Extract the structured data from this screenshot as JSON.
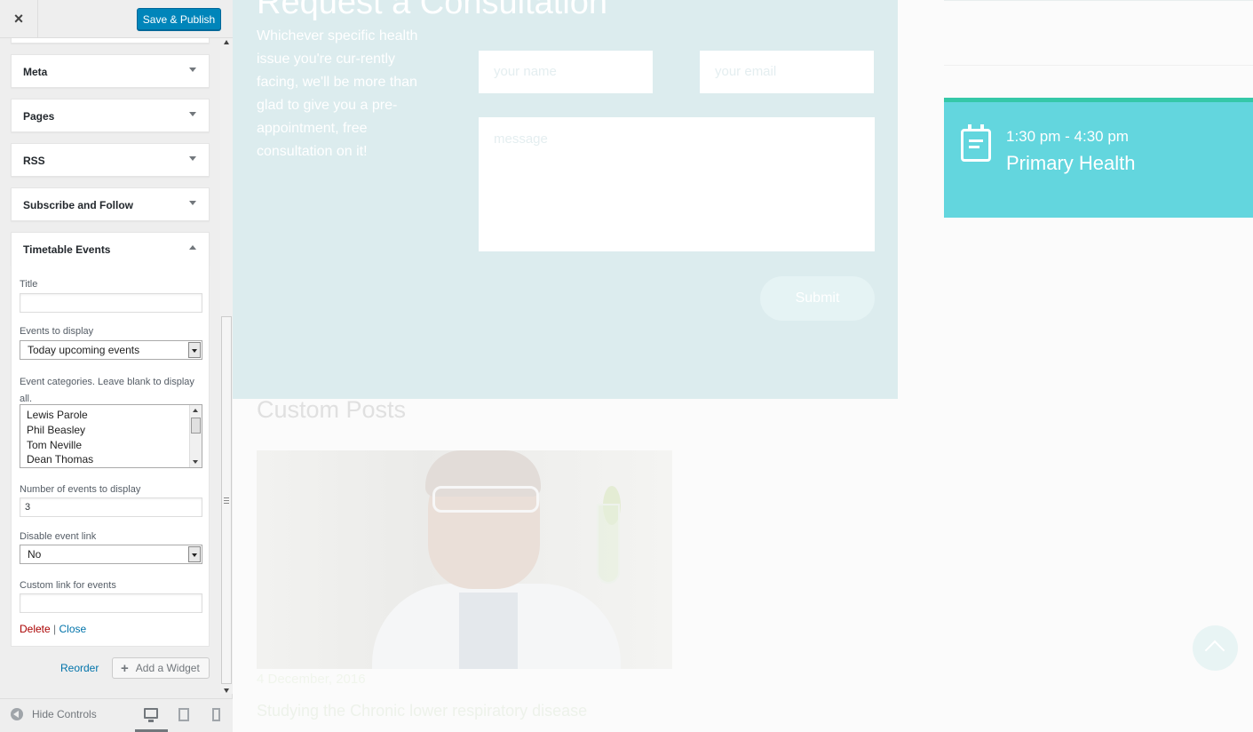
{
  "header": {
    "close_label": "×",
    "publish_label": "Save & Publish"
  },
  "widgets": [
    {
      "title": "Meta"
    },
    {
      "title": "Pages"
    },
    {
      "title": "RSS"
    },
    {
      "title": "Subscribe and Follow"
    },
    {
      "title": "Timetable Events"
    }
  ],
  "timetable_form": {
    "title_label": "Title",
    "title_value": "",
    "events_label": "Events to display",
    "events_value": "Today upcoming events",
    "categories_label": "Event categories. Leave blank to display all.",
    "categories": [
      "Lewis Parole",
      "Phil Beasley",
      "Tom Neville",
      "Dean Thomas"
    ],
    "number_label": "Number of events to display",
    "number_value": "3",
    "disable_link_label": "Disable event link",
    "disable_link_value": "No",
    "custom_link_label": "Custom link for events",
    "custom_link_value": "",
    "delete_label": "Delete",
    "separator": "|",
    "close_label": "Close"
  },
  "section_actions": {
    "reorder_label": "Reorder",
    "add_widget_plus": "+",
    "add_widget_label": "Add a Widget"
  },
  "footer": {
    "hide_controls_label": "Hide Controls",
    "active_device": "desktop"
  },
  "preview": {
    "consult_title": "Request a Consultation",
    "consult_text": "Whichever specific health issue you're cur-rently facing, we'll be more than glad to give you a pre-appointment, free consultation on it!",
    "name_placeholder": "your name",
    "email_placeholder": "your email",
    "message_placeholder": "message",
    "submit_label": "Submit",
    "event_time": "1:30 pm - 4:30 pm",
    "event_name": "Primary Health",
    "posts_title": "Custom Posts",
    "post_date": "4 December, 2016",
    "post_title": "Studying the Chronic lower respiratory disease"
  },
  "colors": {
    "publish": "#0085ba",
    "event_card": "#63d6de",
    "event_border": "#35c8a8",
    "consult_bg": "#dcecee",
    "delete": "#aa0000",
    "link": "#0073aa"
  },
  "icons": {
    "close": "close-icon",
    "widget_toggle": "chevron-down-icon",
    "calendar": "calendar-icon",
    "scroll_top": "chevron-up-icon"
  }
}
